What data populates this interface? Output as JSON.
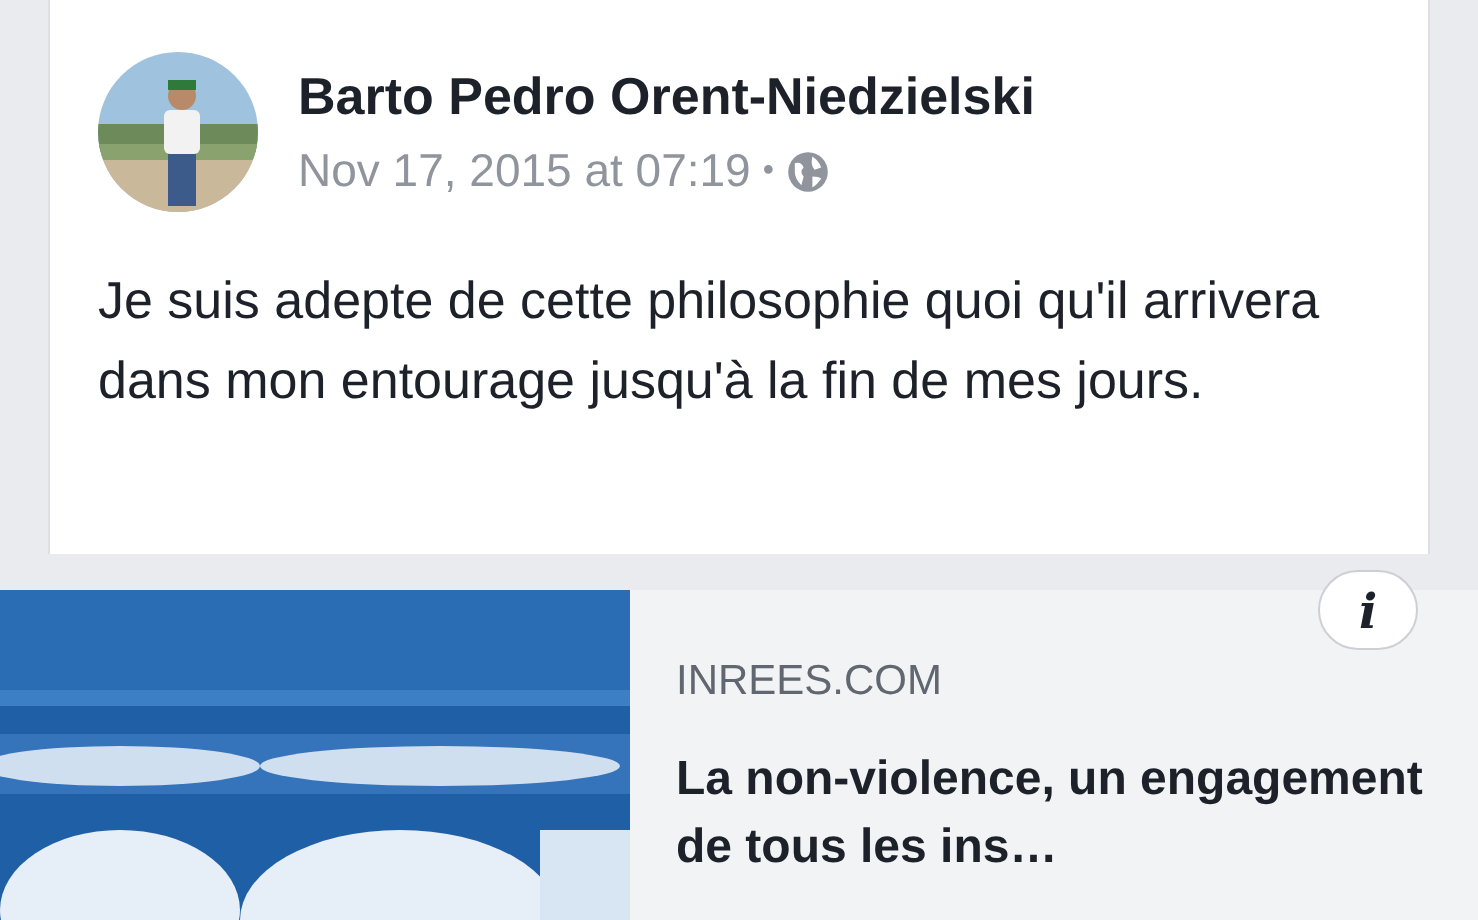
{
  "post": {
    "author": "Barto Pedro Orent-Niedzielski",
    "time": "Nov 17, 2015 at 07:19",
    "separator": "•",
    "text": "Je suis adepte de cette philosophie quoi qu'il arrivera dans mon entourage jusqu'à la fin de mes jours."
  },
  "link_preview": {
    "info": "i",
    "domain": "INREES.COM",
    "title": "La non-violence, un engagement de tous les ins…"
  }
}
